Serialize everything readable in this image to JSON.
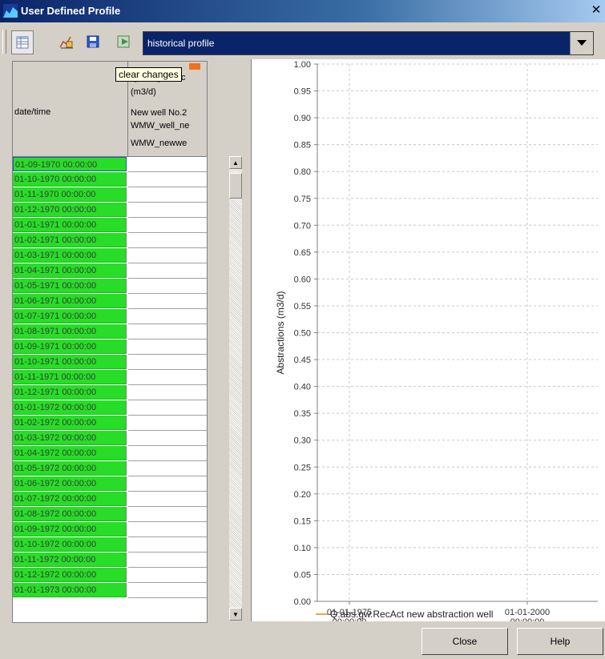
{
  "window": {
    "title": "User Defined Profile"
  },
  "toolbar": {
    "buttons": [
      {
        "icon": "table-view-icon"
      },
      {
        "icon": "chart-edit-icon"
      },
      {
        "icon": "save-icon"
      },
      {
        "icon": "clear-changes-icon"
      }
    ],
    "tooltip": "clear changes",
    "profile_select": {
      "value": "historical profile"
    }
  },
  "table": {
    "datetime_header": "date/time",
    "value_header_lines": [
      "Q.abs.gw.Rec",
      "(m3/d)",
      "New well No.2",
      "WMW_well_ne",
      "WMW_newwe"
    ],
    "rows": [
      "01-09-1970 00:00:00",
      "01-10-1970 00:00:00",
      "01-11-1970 00:00:00",
      "01-12-1970 00:00:00",
      "01-01-1971 00:00:00",
      "01-02-1971 00:00:00",
      "01-03-1971 00:00:00",
      "01-04-1971 00:00:00",
      "01-05-1971 00:00:00",
      "01-06-1971 00:00:00",
      "01-07-1971 00:00:00",
      "01-08-1971 00:00:00",
      "01-09-1971 00:00:00",
      "01-10-1971 00:00:00",
      "01-11-1971 00:00:00",
      "01-12-1971 00:00:00",
      "01-01-1972 00:00:00",
      "01-02-1972 00:00:00",
      "01-03-1972 00:00:00",
      "01-04-1972 00:00:00",
      "01-05-1972 00:00:00",
      "01-06-1972 00:00:00",
      "01-07-1972 00:00:00",
      "01-08-1972 00:00:00",
      "01-09-1972 00:00:00",
      "01-10-1972 00:00:00",
      "01-11-1972 00:00:00",
      "01-12-1972 00:00:00",
      "01-01-1973 00:00:00"
    ]
  },
  "chart_data": {
    "type": "line",
    "ylabel": "Abstractions (m3/d)",
    "ylim": [
      0,
      1
    ],
    "yticks": [
      "0.00",
      "0.05",
      "0.10",
      "0.15",
      "0.20",
      "0.25",
      "0.30",
      "0.35",
      "0.40",
      "0.45",
      "0.50",
      "0.55",
      "0.60",
      "0.65",
      "0.70",
      "0.75",
      "0.80",
      "0.85",
      "0.90",
      "0.95",
      "1.00"
    ],
    "xticks": [
      {
        "date": "01-01-1975",
        "time": "00:00:00"
      },
      {
        "date": "01-01-2000",
        "time": "00:00:00"
      }
    ],
    "grid": true,
    "legend_position": "bottom",
    "series": [
      {
        "name": "Q.abs.gw.RecAct new abstraction well",
        "color": "#d98a1f",
        "values": []
      }
    ]
  },
  "buttons": {
    "close": "Close",
    "help": "Help"
  },
  "colors": {
    "title_bar": "#0a246a",
    "row_highlight": "#27dd27",
    "series_line": "#d98a1f"
  }
}
